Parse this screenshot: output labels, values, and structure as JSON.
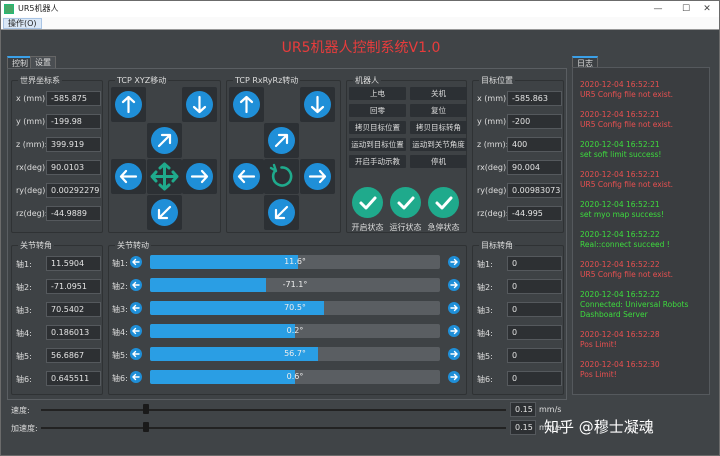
{
  "window": {
    "title": "UR5机器人",
    "minimize": "—",
    "maximize": "☐",
    "close": "✕"
  },
  "menu": {
    "ops": "操作(O)"
  },
  "app_title": "UR5机器人控制系统V1.0",
  "tabs": {
    "control": "控制",
    "settings": "设置",
    "log": "日志"
  },
  "world": {
    "title": "世界坐标系",
    "rows": [
      {
        "label": "x (mm):",
        "value": "-585.875"
      },
      {
        "label": "y (mm):",
        "value": "-199.98"
      },
      {
        "label": "z (mm):",
        "value": "399.919"
      },
      {
        "label": "rx(deg):",
        "value": "90.0103"
      },
      {
        "label": "ry(deg):",
        "value": "0.00292279"
      },
      {
        "label": "rz(deg):",
        "value": "-44.9889"
      }
    ]
  },
  "tcp_xyz": {
    "title": "TCP XYZ移动"
  },
  "tcp_rxyz": {
    "title": "TCP RxRyRz转动"
  },
  "robot": {
    "title": "机器人",
    "buttons": [
      "上电",
      "关机",
      "回零",
      "复位",
      "拷贝目标位置",
      "拷贝目标转角",
      "运动到目标位置",
      "运动到关节角度",
      "开启手动示教",
      "停机"
    ],
    "status": [
      "开启状态",
      "运行状态",
      "急停状态"
    ],
    "status_color": "#1faa8c"
  },
  "target": {
    "title": "目标位置",
    "rows": [
      {
        "label": "x (mm):",
        "value": "-585.863"
      },
      {
        "label": "y (mm):",
        "value": "-200"
      },
      {
        "label": "z (mm):",
        "value": "400"
      },
      {
        "label": "rx(deg):",
        "value": "90.004"
      },
      {
        "label": "ry(deg):",
        "value": "0.00983073"
      },
      {
        "label": "rz(deg):",
        "value": "-44.995"
      }
    ]
  },
  "joint_angles": {
    "title": "关节转角",
    "rows": [
      {
        "label": "轴1:",
        "value": "11.5904"
      },
      {
        "label": "轴2:",
        "value": "-71.0951"
      },
      {
        "label": "轴3:",
        "value": "70.5402"
      },
      {
        "label": "轴4:",
        "value": "0.186013"
      },
      {
        "label": "轴5:",
        "value": "56.6867"
      },
      {
        "label": "轴6:",
        "value": "0.645511"
      }
    ]
  },
  "joint_rotate": {
    "title": "关节转动",
    "rows": [
      {
        "label": "轴1:",
        "text": "11.6°",
        "fraction": 0.51
      },
      {
        "label": "轴2:",
        "text": "-71.1°",
        "fraction": 0.4
      },
      {
        "label": "轴3:",
        "text": "70.5°",
        "fraction": 0.6
      },
      {
        "label": "轴4:",
        "text": "0.2°",
        "fraction": 0.5
      },
      {
        "label": "轴5:",
        "text": "56.7°",
        "fraction": 0.58
      },
      {
        "label": "轴6:",
        "text": "0.6°",
        "fraction": 0.5
      }
    ]
  },
  "target_angles": {
    "title": "目标转角",
    "rows": [
      {
        "label": "轴1:",
        "value": "0"
      },
      {
        "label": "轴2:",
        "value": "0"
      },
      {
        "label": "轴3:",
        "value": "0"
      },
      {
        "label": "轴4:",
        "value": "0"
      },
      {
        "label": "轴5:",
        "value": "0"
      },
      {
        "label": "轴6:",
        "value": "0"
      }
    ]
  },
  "speed": {
    "label": "速度:",
    "value": "0.15",
    "unit": "mm/s",
    "fraction": 0.22
  },
  "accel": {
    "label": "加速度:",
    "value": "0.15",
    "unit": "mm/s",
    "fraction": 0.22
  },
  "log": [
    {
      "time": "2020-12-04 16:52:21",
      "msg": "UR5 Config file not exist.",
      "color": "#e85050"
    },
    {
      "time": "2020-12-04 16:52:21",
      "msg": "UR5 Config file not exist.",
      "color": "#e85050"
    },
    {
      "time": "2020-12-04 16:52:21",
      "msg": "set soft limit success!",
      "color": "#3ddc3d"
    },
    {
      "time": "2020-12-04 16:52:21",
      "msg": "UR5 Config file not exist.",
      "color": "#e85050"
    },
    {
      "time": "2020-12-04 16:52:21",
      "msg": "set myo map success!",
      "color": "#3ddc3d"
    },
    {
      "time": "2020-12-04 16:52:22",
      "msg": "Real::connect succeed !",
      "color": "#3ddc3d"
    },
    {
      "time": "2020-12-04 16:52:22",
      "msg": "UR5 Config file not exist.",
      "color": "#e85050"
    },
    {
      "time": "2020-12-04 16:52:22",
      "msg": "Connected: Universal Robots Dashboard Server",
      "color": "#3ddc3d"
    },
    {
      "time": "2020-12-04 16:52:28",
      "msg": "Pos Limit!",
      "color": "#e85050"
    },
    {
      "time": "2020-12-04 16:52:30",
      "msg": "Pos Limit!",
      "color": "#e85050"
    }
  ],
  "watermark": "知乎 @穆士凝魂"
}
